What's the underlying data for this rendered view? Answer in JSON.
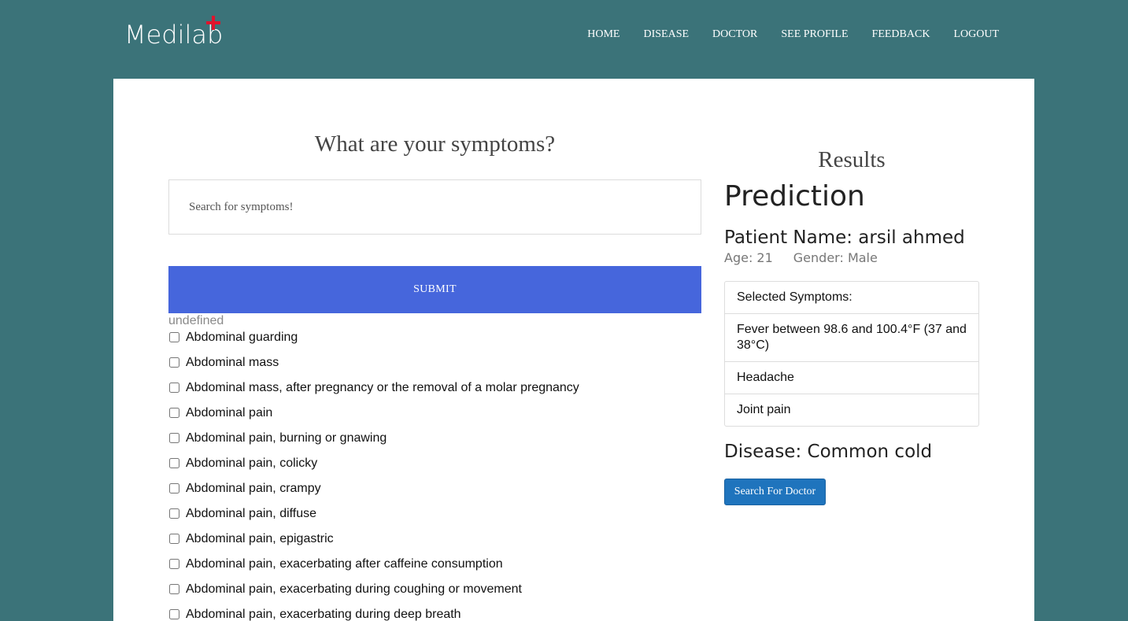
{
  "brand": {
    "logo_text": "Medilab",
    "accent_color": "#e0142c",
    "bg_color": "#3b7379"
  },
  "nav": {
    "items": [
      "HOME",
      "DISEASE",
      "DOCTOR",
      "SEE PROFILE",
      "FEEDBACK",
      "LOGOUT"
    ]
  },
  "symptoms_form": {
    "title": "What are your symptoms?",
    "search_placeholder": "Search for symptoms!",
    "submit_label": "SUBMIT",
    "status_text": "undefined",
    "options": [
      "Abdominal guarding",
      "Abdominal mass",
      "Abdominal mass, after pregnancy or the removal of a molar pregnancy",
      "Abdominal pain",
      "Abdominal pain, burning or gnawing",
      "Abdominal pain, colicky",
      "Abdominal pain, crampy",
      "Abdominal pain, diffuse",
      "Abdominal pain, epigastric",
      "Abdominal pain, exacerbating after caffeine consumption",
      "Abdominal pain, exacerbating during coughing or movement",
      "Abdominal pain, exacerbating during deep breath"
    ]
  },
  "results": {
    "title": "Results",
    "heading": "Prediction",
    "patient_name": "Patient Name: arsil ahmed",
    "age": "Age: 21",
    "gender": "Gender: Male",
    "selected_header": "Selected Symptoms:",
    "selected_symptoms": [
      "Fever between 98.6 and 100.4°F (37 and 38°C)",
      "Headache",
      "Joint pain"
    ],
    "disease": "Disease: Common cold",
    "doctor_button": "Search For Doctor"
  }
}
